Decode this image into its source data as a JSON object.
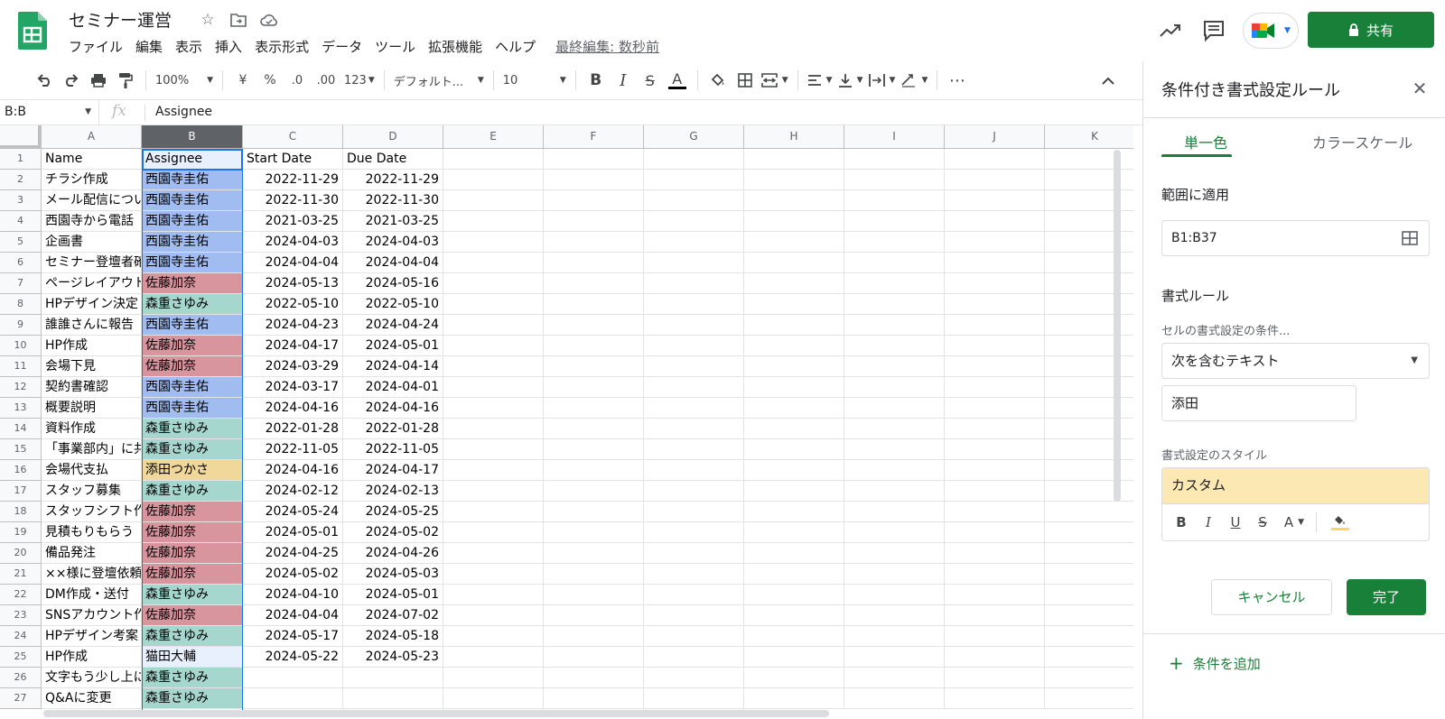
{
  "doc": {
    "title": "セミナー運営",
    "menu": [
      "ファイル",
      "編集",
      "表示",
      "挿入",
      "表示形式",
      "データ",
      "ツール",
      "拡張機能",
      "ヘルプ"
    ],
    "last_edit": "最終編集: 数秒前",
    "share_label": "共有"
  },
  "toolbar": {
    "zoom": "100%",
    "currency": "¥",
    "percent": "%",
    "dec_decrease": ".0",
    "dec_increase": ".00",
    "format_more": "123",
    "font": "デフォルト...",
    "font_size": "10"
  },
  "formula_bar": {
    "name_box": "B:B",
    "value": "Assignee"
  },
  "colors": {
    "blue": "#a0bcf0",
    "red": "#d8959e",
    "teal": "#a6d7cf",
    "yellow": "#f0d79a",
    "light": "#e8f0fe",
    "accent": "#188038"
  },
  "sheet": {
    "columns": [
      "A",
      "B",
      "C",
      "D",
      "E",
      "F",
      "G",
      "H",
      "I",
      "J",
      "K"
    ],
    "rows": [
      {
        "n": "1",
        "a": "Name",
        "b": "Assignee",
        "c": "Start Date",
        "d": "Due Date",
        "color": "light"
      },
      {
        "n": "2",
        "a": "チラシ作成",
        "b": "西園寺圭佑",
        "c": "2022-11-29",
        "d": "2022-11-29",
        "color": "blue"
      },
      {
        "n": "3",
        "a": "メール配信につい",
        "b": "西園寺圭佑",
        "c": "2022-11-30",
        "d": "2022-11-30",
        "color": "blue"
      },
      {
        "n": "4",
        "a": "西園寺から電話",
        "b": "西園寺圭佑",
        "c": "2021-03-25",
        "d": "2021-03-25",
        "color": "blue"
      },
      {
        "n": "5",
        "a": "企画書",
        "b": "西園寺圭佑",
        "c": "2024-04-03",
        "d": "2024-04-03",
        "color": "blue"
      },
      {
        "n": "6",
        "a": "セミナー登壇者確",
        "b": "西園寺圭佑",
        "c": "2024-04-04",
        "d": "2024-04-04",
        "color": "blue"
      },
      {
        "n": "7",
        "a": "ページレイアウト",
        "b": "佐藤加奈",
        "c": "2024-05-13",
        "d": "2024-05-16",
        "color": "red"
      },
      {
        "n": "8",
        "a": "HPデザイン決定",
        "b": "森重さゆみ",
        "c": "2022-05-10",
        "d": "2022-05-10",
        "color": "teal"
      },
      {
        "n": "9",
        "a": "誰誰さんに報告",
        "b": "西園寺圭佑",
        "c": "2024-04-23",
        "d": "2024-04-24",
        "color": "blue"
      },
      {
        "n": "10",
        "a": "HP作成",
        "b": "佐藤加奈",
        "c": "2024-04-17",
        "d": "2024-05-01",
        "color": "red"
      },
      {
        "n": "11",
        "a": "会場下見",
        "b": "佐藤加奈",
        "c": "2024-03-29",
        "d": "2024-04-14",
        "color": "red"
      },
      {
        "n": "12",
        "a": "契約書確認",
        "b": "西園寺圭佑",
        "c": "2024-03-17",
        "d": "2024-04-01",
        "color": "blue"
      },
      {
        "n": "13",
        "a": "概要説明",
        "b": "西園寺圭佑",
        "c": "2024-04-16",
        "d": "2024-04-16",
        "color": "blue"
      },
      {
        "n": "14",
        "a": "資料作成",
        "b": "森重さゆみ",
        "c": "2022-01-28",
        "d": "2022-01-28",
        "color": "teal"
      },
      {
        "n": "15",
        "a": "「事業部内」に共",
        "b": "森重さゆみ",
        "c": "2022-11-05",
        "d": "2022-11-05",
        "color": "teal"
      },
      {
        "n": "16",
        "a": "会場代支払",
        "b": "添田つかさ",
        "c": "2024-04-16",
        "d": "2024-04-17",
        "color": "yellow"
      },
      {
        "n": "17",
        "a": "スタッフ募集",
        "b": "森重さゆみ",
        "c": "2024-02-12",
        "d": "2024-02-13",
        "color": "teal"
      },
      {
        "n": "18",
        "a": "スタッフシフト作",
        "b": "佐藤加奈",
        "c": "2024-05-24",
        "d": "2024-05-25",
        "color": "red"
      },
      {
        "n": "19",
        "a": "見積もりもらう",
        "b": "佐藤加奈",
        "c": "2024-05-01",
        "d": "2024-05-02",
        "color": "red"
      },
      {
        "n": "20",
        "a": "備品発注",
        "b": "佐藤加奈",
        "c": "2024-04-25",
        "d": "2024-04-26",
        "color": "red"
      },
      {
        "n": "21",
        "a": "××様に登壇依頼",
        "b": "佐藤加奈",
        "c": "2024-05-02",
        "d": "2024-05-03",
        "color": "red"
      },
      {
        "n": "22",
        "a": "DM作成・送付",
        "b": "森重さゆみ",
        "c": "2024-04-10",
        "d": "2024-05-01",
        "color": "teal"
      },
      {
        "n": "23",
        "a": "SNSアカウント作",
        "b": "佐藤加奈",
        "c": "2024-04-04",
        "d": "2024-07-02",
        "color": "red"
      },
      {
        "n": "24",
        "a": "HPデザイン考案",
        "b": "森重さゆみ",
        "c": "2024-05-17",
        "d": "2024-05-18",
        "color": "teal"
      },
      {
        "n": "25",
        "a": "HP作成",
        "b": "猫田大輔",
        "c": "2024-05-22",
        "d": "2024-05-23",
        "color": "light"
      },
      {
        "n": "26",
        "a": "文字もう少し上に",
        "b": "森重さゆみ",
        "c": "",
        "d": "",
        "color": "teal"
      },
      {
        "n": "27",
        "a": "Q&Aに変更",
        "b": "森重さゆみ",
        "c": "",
        "d": "",
        "color": "teal"
      }
    ]
  },
  "panel": {
    "title": "条件付き書式設定ルール",
    "tab_single": "単一色",
    "tab_scale": "カラースケール",
    "range_label": "範囲に適用",
    "range_value": "B1:B37",
    "rules_label": "書式ルール",
    "condition_label": "セルの書式設定の条件...",
    "condition_value": "次を含むテキスト",
    "condition_text": "添田",
    "style_label": "書式設定のスタイル",
    "style_preview": "カスタム",
    "cancel_label": "キャンセル",
    "done_label": "完了",
    "add_rule_label": "条件を追加",
    "style_fill_color": "#fdd663"
  }
}
